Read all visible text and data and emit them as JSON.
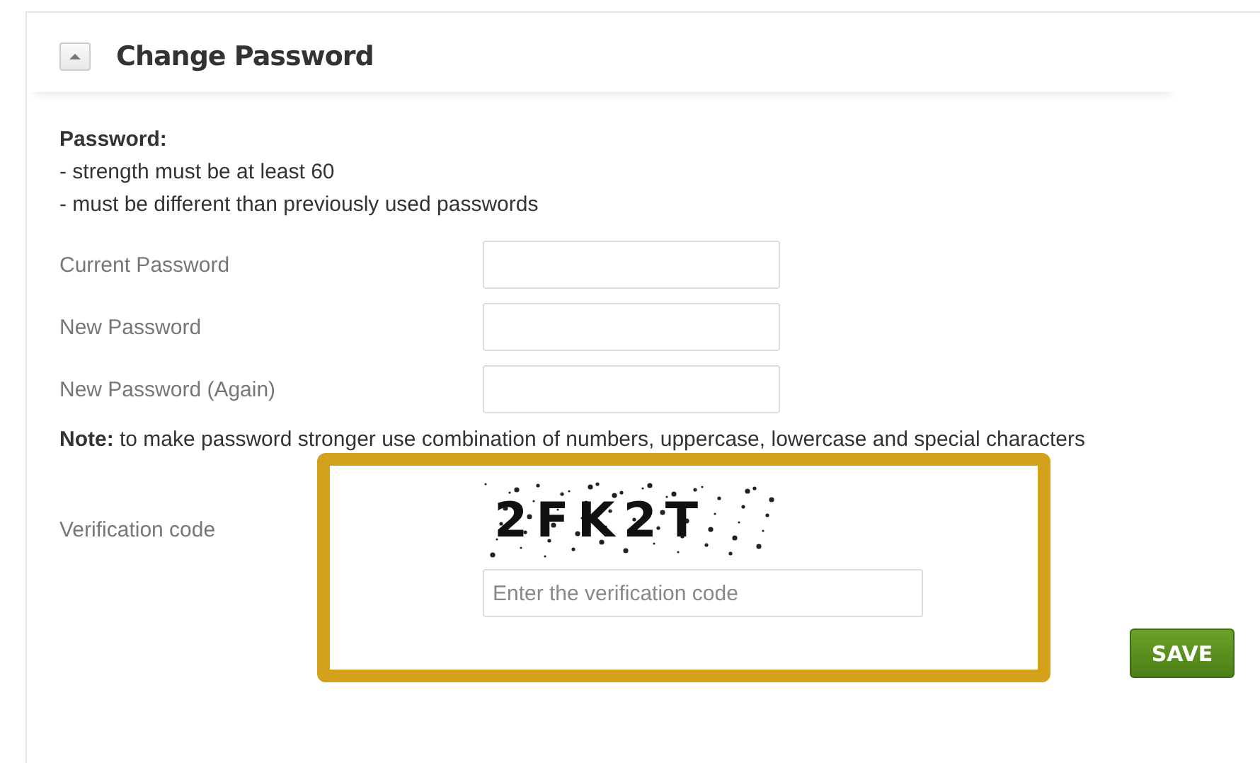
{
  "panel": {
    "title": "Change Password",
    "expanded": true
  },
  "rules": {
    "heading": "Password:",
    "lines": [
      "- strength must be at least 60",
      "- must be different than previously used passwords"
    ]
  },
  "fields": [
    {
      "label": "Current Password"
    },
    {
      "label": "New Password"
    },
    {
      "label": "New Password (Again)"
    }
  ],
  "note": "**Note:** to make password stronger use combination of numbers, uppercase, lowercase and special characters",
  "verification": {
    "label": "Verification code",
    "captcha": "2FK2T",
    "placeholder": "Enter the verification code",
    "highlighted": true
  },
  "buttons": [
    "SAVE"
  ]
}
